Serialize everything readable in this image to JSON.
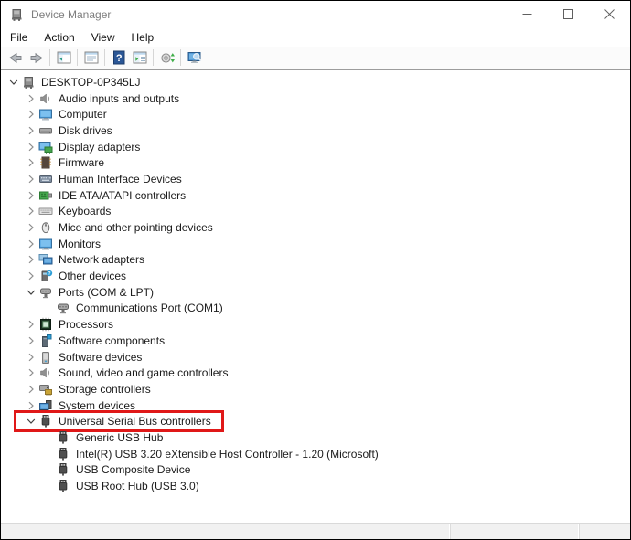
{
  "window": {
    "title": "Device Manager",
    "app_icon": "device-manager"
  },
  "menu": {
    "items": [
      "File",
      "Action",
      "View",
      "Help"
    ]
  },
  "toolbar": {
    "buttons": [
      "back",
      "forward",
      "|",
      "show-console-tree",
      "|",
      "properties",
      "|",
      "help",
      "show-action-pane",
      "|",
      "scan-hardware-changes",
      "|",
      "device-manager-view"
    ]
  },
  "tree": {
    "items": [
      {
        "label": "DESKTOP-0P345LJ",
        "icon": "desktop-computer",
        "level": 0,
        "state": "expanded",
        "highlighted": false
      },
      {
        "label": "Audio inputs and outputs",
        "icon": "speaker",
        "level": 1,
        "state": "collapsed",
        "highlighted": false
      },
      {
        "label": "Computer",
        "icon": "monitor",
        "level": 1,
        "state": "collapsed",
        "highlighted": false
      },
      {
        "label": "Disk drives",
        "icon": "hard-disk",
        "level": 1,
        "state": "collapsed",
        "highlighted": false
      },
      {
        "label": "Display adapters",
        "icon": "display-adapter",
        "level": 1,
        "state": "collapsed",
        "highlighted": false
      },
      {
        "label": "Firmware",
        "icon": "firmware-chip",
        "level": 1,
        "state": "collapsed",
        "highlighted": false
      },
      {
        "label": "Human Interface Devices",
        "icon": "hid-device",
        "level": 1,
        "state": "collapsed",
        "highlighted": false
      },
      {
        "label": "IDE ATA/ATAPI controllers",
        "icon": "ide-controller",
        "level": 1,
        "state": "collapsed",
        "highlighted": false
      },
      {
        "label": "Keyboards",
        "icon": "keyboard",
        "level": 1,
        "state": "collapsed",
        "highlighted": false
      },
      {
        "label": "Mice and other pointing devices",
        "icon": "mouse",
        "level": 1,
        "state": "collapsed",
        "highlighted": false
      },
      {
        "label": "Monitors",
        "icon": "monitor",
        "level": 1,
        "state": "collapsed",
        "highlighted": false
      },
      {
        "label": "Network adapters",
        "icon": "network-adapter",
        "level": 1,
        "state": "collapsed",
        "highlighted": false
      },
      {
        "label": "Other devices",
        "icon": "unknown-device",
        "level": 1,
        "state": "collapsed",
        "highlighted": false
      },
      {
        "label": "Ports (COM & LPT)",
        "icon": "serial-port",
        "level": 1,
        "state": "expanded",
        "highlighted": false
      },
      {
        "label": "Communications Port (COM1)",
        "icon": "serial-port",
        "level": 2,
        "state": "none",
        "highlighted": false
      },
      {
        "label": "Processors",
        "icon": "processor-chip",
        "level": 1,
        "state": "collapsed",
        "highlighted": false
      },
      {
        "label": "Software components",
        "icon": "software-component",
        "level": 1,
        "state": "collapsed",
        "highlighted": false
      },
      {
        "label": "Software devices",
        "icon": "software-device",
        "level": 1,
        "state": "collapsed",
        "highlighted": false
      },
      {
        "label": "Sound, video and game controllers",
        "icon": "speaker",
        "level": 1,
        "state": "collapsed",
        "highlighted": false
      },
      {
        "label": "Storage controllers",
        "icon": "storage-controller",
        "level": 1,
        "state": "collapsed",
        "highlighted": false
      },
      {
        "label": "System devices",
        "icon": "system-device",
        "level": 1,
        "state": "collapsed",
        "highlighted": false
      },
      {
        "label": "Universal Serial Bus controllers",
        "icon": "usb-plug",
        "level": 1,
        "state": "expanded",
        "highlighted": true
      },
      {
        "label": "Generic USB Hub",
        "icon": "usb-plug",
        "level": 2,
        "state": "none",
        "highlighted": false
      },
      {
        "label": "Intel(R) USB 3.20 eXtensible Host Controller - 1.20 (Microsoft)",
        "icon": "usb-plug",
        "level": 2,
        "state": "none",
        "highlighted": false
      },
      {
        "label": "USB Composite Device",
        "icon": "usb-plug",
        "level": 2,
        "state": "none",
        "highlighted": false
      },
      {
        "label": "USB Root Hub (USB 3.0)",
        "icon": "usb-plug",
        "level": 2,
        "state": "none",
        "highlighted": false
      }
    ]
  },
  "highlight": {
    "color": "#e01818",
    "target": "Universal Serial Bus controllers"
  },
  "colors": {
    "title_text": "#7e7e7e",
    "toolbar_border": "#9c9c9c",
    "status_bar_bg": "#f1f1f1"
  }
}
